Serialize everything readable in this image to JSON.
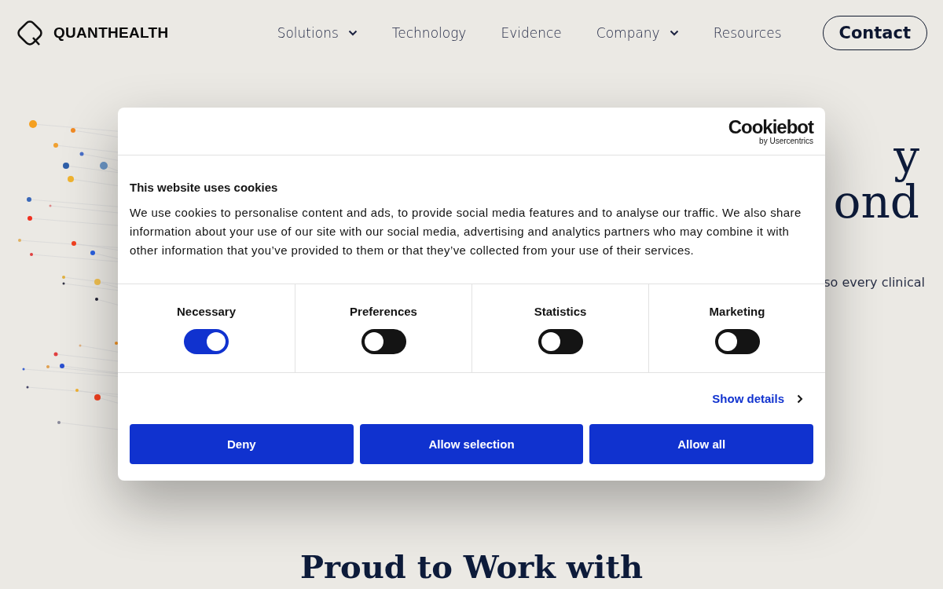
{
  "header": {
    "logo": "QUANTHEALTH",
    "nav": [
      {
        "label": "Solutions",
        "has_menu": true
      },
      {
        "label": "Technology",
        "has_menu": false
      },
      {
        "label": "Evidence",
        "has_menu": false
      },
      {
        "label": "Company",
        "has_menu": true
      },
      {
        "label": "Resources",
        "has_menu": false
      }
    ],
    "contact": "Contact"
  },
  "hero": {
    "title_fragments": [
      "y",
      "ond"
    ],
    "subtitle_fragment": "so every clinical"
  },
  "section_heading": "Proud to Work with",
  "cookie_dialog": {
    "brand": "Cookiebot",
    "brand_sub": "by Usercentrics",
    "title": "This website uses cookies",
    "body": "We use cookies to personalise content and ads, to provide social media features and to analyse our traffic. We also share information about your use of our site with our social media, advertising and analytics partners who may combine it with other information that you’ve provided to them or that they’ve collected from your use of their services.",
    "categories": [
      {
        "label": "Necessary",
        "checked": true
      },
      {
        "label": "Preferences",
        "checked": false
      },
      {
        "label": "Statistics",
        "checked": false
      },
      {
        "label": "Marketing",
        "checked": false
      }
    ],
    "details_link": "Show details",
    "buttons": [
      "Deny",
      "Allow selection",
      "Allow all"
    ]
  }
}
